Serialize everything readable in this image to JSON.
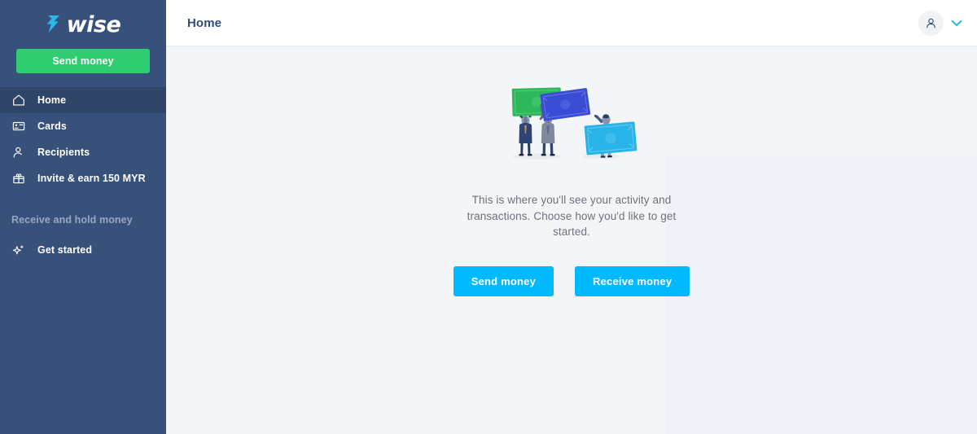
{
  "brand": {
    "logo_text": "wise",
    "logo_mark_icon": "wise-arrow-icon",
    "navy": "#37517A",
    "green": "#2FCC71",
    "bright_blue": "#00B9FF",
    "active_nav": "#2F4668"
  },
  "sidebar": {
    "cta_label": "Send money",
    "items": [
      {
        "label": "Home",
        "icon": "home-icon",
        "active": true
      },
      {
        "label": "Cards",
        "icon": "card-icon",
        "active": false
      },
      {
        "label": "Recipients",
        "icon": "person-icon",
        "active": false
      },
      {
        "label": "Invite & earn 150 MYR",
        "icon": "gift-icon",
        "active": false
      }
    ],
    "section_title": "Receive and hold money",
    "section_items": [
      {
        "label": "Get started",
        "icon": "sparkle-icon"
      }
    ]
  },
  "topbar": {
    "title": "Home",
    "avatar_icon": "person-avatar-icon",
    "chevron_icon": "chevron-down-icon"
  },
  "empty_state": {
    "illustration_name": "people-holding-banknotes-illustration",
    "message": "This is where you'll see your activity and transactions. Choose how you'd like to get started.",
    "primary_label": "Send money",
    "secondary_label": "Receive money"
  }
}
